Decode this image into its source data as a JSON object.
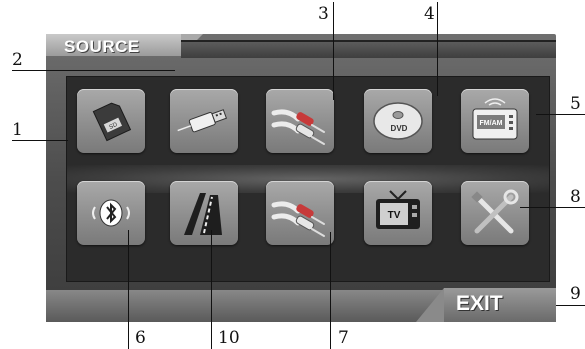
{
  "screen": {
    "title": "SOURCE",
    "exit_label": "EXIT"
  },
  "buttons": [
    {
      "name": "sd-card",
      "icon": "sd-card-icon"
    },
    {
      "name": "usb",
      "icon": "usb-icon"
    },
    {
      "name": "av-in-1",
      "icon": "rca-cable-icon"
    },
    {
      "name": "dvd",
      "icon": "dvd-disc-icon",
      "text": "DVD"
    },
    {
      "name": "radio",
      "icon": "radio-icon",
      "text": "FM/AM"
    },
    {
      "name": "bluetooth",
      "icon": "bluetooth-icon"
    },
    {
      "name": "navigation",
      "icon": "road-icon"
    },
    {
      "name": "av-in-2",
      "icon": "rca-cable-icon"
    },
    {
      "name": "tv",
      "icon": "tv-icon",
      "text": "TV"
    },
    {
      "name": "settings",
      "icon": "tools-icon"
    }
  ],
  "callouts": [
    "1",
    "2",
    "3",
    "4",
    "5",
    "6",
    "10",
    "7",
    "8",
    "9"
  ]
}
